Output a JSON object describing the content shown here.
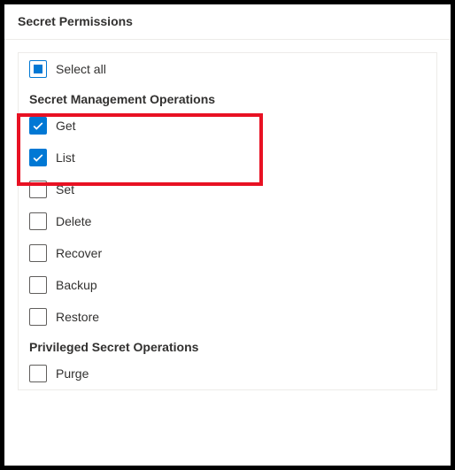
{
  "header": {
    "title": "Secret Permissions"
  },
  "selectAll": {
    "label": "Select all",
    "state": "indeterminate"
  },
  "sections": {
    "management": {
      "title": "Secret Management Operations",
      "items": {
        "get": {
          "label": "Get",
          "checked": true
        },
        "list": {
          "label": "List",
          "checked": true
        },
        "set": {
          "label": "Set",
          "checked": false
        },
        "delete": {
          "label": "Delete",
          "checked": false
        },
        "recover": {
          "label": "Recover",
          "checked": false
        },
        "backup": {
          "label": "Backup",
          "checked": false
        },
        "restore": {
          "label": "Restore",
          "checked": false
        }
      }
    },
    "privileged": {
      "title": "Privileged Secret Operations",
      "items": {
        "purge": {
          "label": "Purge",
          "checked": false
        }
      }
    }
  },
  "colors": {
    "accent": "#0078d4",
    "highlight": "#e81123"
  }
}
